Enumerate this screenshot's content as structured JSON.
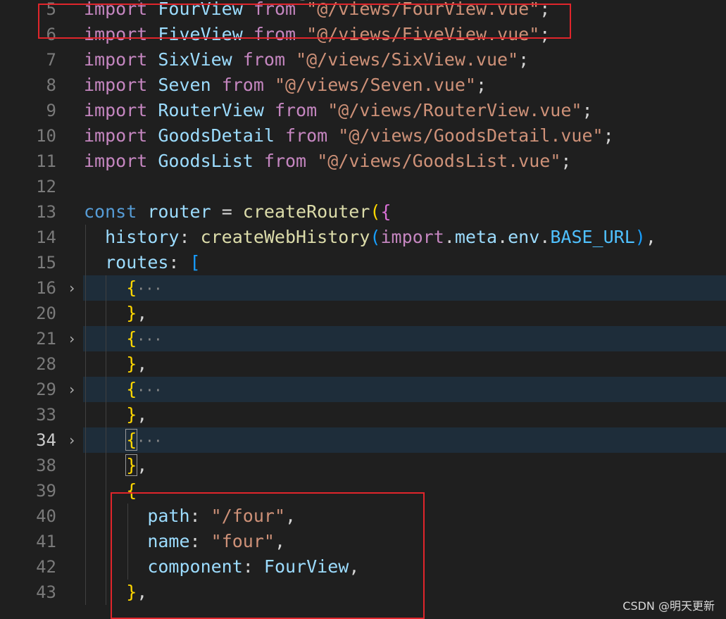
{
  "editor": {
    "lines": [
      {
        "num": "5",
        "tokens": [
          [
            "kw",
            "import"
          ],
          [
            "plain",
            " "
          ],
          [
            "id",
            "FourView"
          ],
          [
            "plain",
            " "
          ],
          [
            "kw",
            "from"
          ],
          [
            "plain",
            " "
          ],
          [
            "str",
            "\"@/views/FourView.vue\""
          ],
          [
            "plain",
            ";"
          ]
        ]
      },
      {
        "num": "6",
        "tokens": [
          [
            "kw",
            "import"
          ],
          [
            "plain",
            " "
          ],
          [
            "id",
            "FiveView"
          ],
          [
            "plain",
            " "
          ],
          [
            "kw",
            "from"
          ],
          [
            "plain",
            " "
          ],
          [
            "str",
            "\"@/views/FiveView.vue\""
          ],
          [
            "plain",
            ";"
          ]
        ]
      },
      {
        "num": "7",
        "tokens": [
          [
            "kw",
            "import"
          ],
          [
            "plain",
            " "
          ],
          [
            "id",
            "SixView"
          ],
          [
            "plain",
            " "
          ],
          [
            "kw",
            "from"
          ],
          [
            "plain",
            " "
          ],
          [
            "str",
            "\"@/views/SixView.vue\""
          ],
          [
            "plain",
            ";"
          ]
        ]
      },
      {
        "num": "8",
        "tokens": [
          [
            "kw",
            "import"
          ],
          [
            "plain",
            " "
          ],
          [
            "id",
            "Seven"
          ],
          [
            "plain",
            " "
          ],
          [
            "kw",
            "from"
          ],
          [
            "plain",
            " "
          ],
          [
            "str",
            "\"@/views/Seven.vue\""
          ],
          [
            "plain",
            ";"
          ]
        ]
      },
      {
        "num": "9",
        "tokens": [
          [
            "kw",
            "import"
          ],
          [
            "plain",
            " "
          ],
          [
            "id",
            "RouterView"
          ],
          [
            "plain",
            " "
          ],
          [
            "kw",
            "from"
          ],
          [
            "plain",
            " "
          ],
          [
            "str",
            "\"@/views/RouterView.vue\""
          ],
          [
            "plain",
            ";"
          ]
        ]
      },
      {
        "num": "10",
        "tokens": [
          [
            "kw",
            "import"
          ],
          [
            "plain",
            " "
          ],
          [
            "id",
            "GoodsDetail"
          ],
          [
            "plain",
            " "
          ],
          [
            "kw",
            "from"
          ],
          [
            "plain",
            " "
          ],
          [
            "str",
            "\"@/views/GoodsDetail.vue\""
          ],
          [
            "plain",
            ";"
          ]
        ]
      },
      {
        "num": "11",
        "tokens": [
          [
            "kw",
            "import"
          ],
          [
            "plain",
            " "
          ],
          [
            "id",
            "GoodsList"
          ],
          [
            "plain",
            " "
          ],
          [
            "kw",
            "from"
          ],
          [
            "plain",
            " "
          ],
          [
            "str",
            "\"@/views/GoodsList.vue\""
          ],
          [
            "plain",
            ";"
          ]
        ]
      },
      {
        "num": "12",
        "tokens": []
      },
      {
        "num": "13",
        "tokens": [
          [
            "const",
            "const"
          ],
          [
            "plain",
            " "
          ],
          [
            "id",
            "router"
          ],
          [
            "plain",
            " = "
          ],
          [
            "fn",
            "createRouter"
          ],
          [
            "br1",
            "("
          ],
          [
            "br2",
            "{"
          ]
        ]
      },
      {
        "num": "14",
        "tokens": [
          [
            "plain",
            "  "
          ],
          [
            "prop",
            "history"
          ],
          [
            "plain",
            ": "
          ],
          [
            "fn",
            "createWebHistory"
          ],
          [
            "br3",
            "("
          ],
          [
            "kw",
            "import"
          ],
          [
            "plain",
            "."
          ],
          [
            "prop",
            "meta"
          ],
          [
            "plain",
            "."
          ],
          [
            "prop",
            "env"
          ],
          [
            "plain",
            "."
          ],
          [
            "cconst",
            "BASE_URL"
          ],
          [
            "br3",
            ")"
          ],
          [
            "plain",
            ","
          ]
        ]
      },
      {
        "num": "15",
        "tokens": [
          [
            "plain",
            "  "
          ],
          [
            "prop",
            "routes"
          ],
          [
            "plain",
            ": "
          ],
          [
            "br3",
            "["
          ]
        ]
      },
      {
        "num": "16",
        "fold": true,
        "tokens": [
          [
            "plain",
            "    "
          ],
          [
            "br1",
            "{"
          ],
          [
            "ell",
            "···"
          ]
        ]
      },
      {
        "num": "20",
        "tokens": [
          [
            "plain",
            "    "
          ],
          [
            "br1",
            "}"
          ],
          [
            "plain",
            ","
          ]
        ]
      },
      {
        "num": "21",
        "fold": true,
        "tokens": [
          [
            "plain",
            "    "
          ],
          [
            "br1",
            "{"
          ],
          [
            "ell",
            "···"
          ]
        ]
      },
      {
        "num": "28",
        "tokens": [
          [
            "plain",
            "    "
          ],
          [
            "br1",
            "}"
          ],
          [
            "plain",
            ","
          ]
        ]
      },
      {
        "num": "29",
        "fold": true,
        "tokens": [
          [
            "plain",
            "    "
          ],
          [
            "br1",
            "{"
          ],
          [
            "ell",
            "···"
          ]
        ]
      },
      {
        "num": "33",
        "tokens": [
          [
            "plain",
            "    "
          ],
          [
            "br1",
            "}"
          ],
          [
            "plain",
            ","
          ]
        ]
      },
      {
        "num": "34",
        "fold": true,
        "active": true,
        "tokens": [
          [
            "plain",
            "    "
          ],
          [
            "br1 cursorbox",
            "{"
          ],
          [
            "ell",
            "···"
          ]
        ]
      },
      {
        "num": "38",
        "tokens": [
          [
            "plain",
            "    "
          ],
          [
            "br1 cursorbox",
            "}"
          ],
          [
            "plain",
            ","
          ]
        ]
      },
      {
        "num": "39",
        "tokens": [
          [
            "plain",
            "    "
          ],
          [
            "br1",
            "{"
          ]
        ]
      },
      {
        "num": "40",
        "tokens": [
          [
            "plain",
            "      "
          ],
          [
            "prop",
            "path"
          ],
          [
            "plain",
            ": "
          ],
          [
            "str",
            "\"/four\""
          ],
          [
            "plain",
            ","
          ]
        ]
      },
      {
        "num": "41",
        "tokens": [
          [
            "plain",
            "      "
          ],
          [
            "prop",
            "name"
          ],
          [
            "plain",
            ": "
          ],
          [
            "str",
            "\"four\""
          ],
          [
            "plain",
            ","
          ]
        ]
      },
      {
        "num": "42",
        "tokens": [
          [
            "plain",
            "      "
          ],
          [
            "prop",
            "component"
          ],
          [
            "plain",
            ": "
          ],
          [
            "id",
            "FourView"
          ],
          [
            "plain",
            ","
          ]
        ]
      },
      {
        "num": "43",
        "tokens": [
          [
            "plain",
            "    "
          ],
          [
            "br1",
            "}"
          ],
          [
            "plain",
            ","
          ]
        ]
      }
    ]
  },
  "watermark": "CSDN @明天更新"
}
